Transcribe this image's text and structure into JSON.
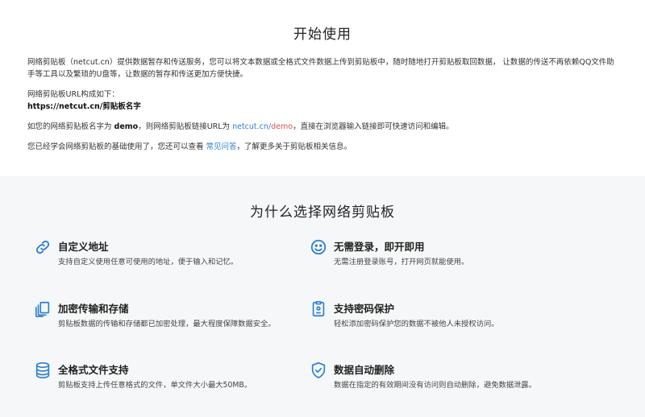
{
  "intro": {
    "title": "开始使用",
    "p1": "网络剪贴板（netcut.cn）提供数据暂存和传送服务，您可以将文本数据或全格式文件数据上传到剪贴板中，随时随地打开剪贴板取回数据， 让数据的传送不再依赖QQ文件助手等工具以及繁琐的U盘等，让数据的暂存和传送更加方便快捷。",
    "url_intro": "网络剪贴板URL构成如下：",
    "url_pattern": "https://netcut.cn/剪贴板名字",
    "example_prefix": "如您的网络剪贴板名字为 ",
    "example_name": "demo",
    "example_mid": "，则网络剪贴板链接URL为 ",
    "example_link_host": "netcut.cn/",
    "example_link_path": "demo",
    "example_suffix": "，直接在浏览器输入链接即可快速访问和编辑。",
    "faq_prefix": "您已经学会网络剪贴板的基础使用了，您还可以查看 ",
    "faq_link": "常见问答",
    "faq_suffix": "，了解更多关于剪贴板相关信息。"
  },
  "features": {
    "title": "为什么选择网络剪贴板",
    "items": [
      {
        "icon": "link-icon",
        "title": "自定义地址",
        "desc": "支持自定义使用任意可使用的地址，便于输入和记忆。"
      },
      {
        "icon": "smile-icon",
        "title": "无需登录，即开即用",
        "desc": "无需注册登录账号，打开网页就能使用。"
      },
      {
        "icon": "copy-files-icon",
        "title": "加密传输和存储",
        "desc": "剪贴板数据的传输和存储都已加密处理，最大程度保障数据安全。"
      },
      {
        "icon": "password-icon",
        "title": "支持密码保护",
        "desc": "轻松添加密码保护您的数据不被他人未授权访问。"
      },
      {
        "icon": "database-icon",
        "title": "全格式文件支持",
        "desc": "剪贴板支持上传任意格式的文件，单文件大小最大50MB。"
      },
      {
        "icon": "shield-check-icon",
        "title": "数据自动删除",
        "desc": "数据在指定的有效期间没有访问则自动删除，避免数据泄露。"
      }
    ]
  },
  "colors": {
    "accent_blue": "#2b7fd0",
    "link_red": "#d9534f",
    "features_bg": "#f6f7f8"
  }
}
